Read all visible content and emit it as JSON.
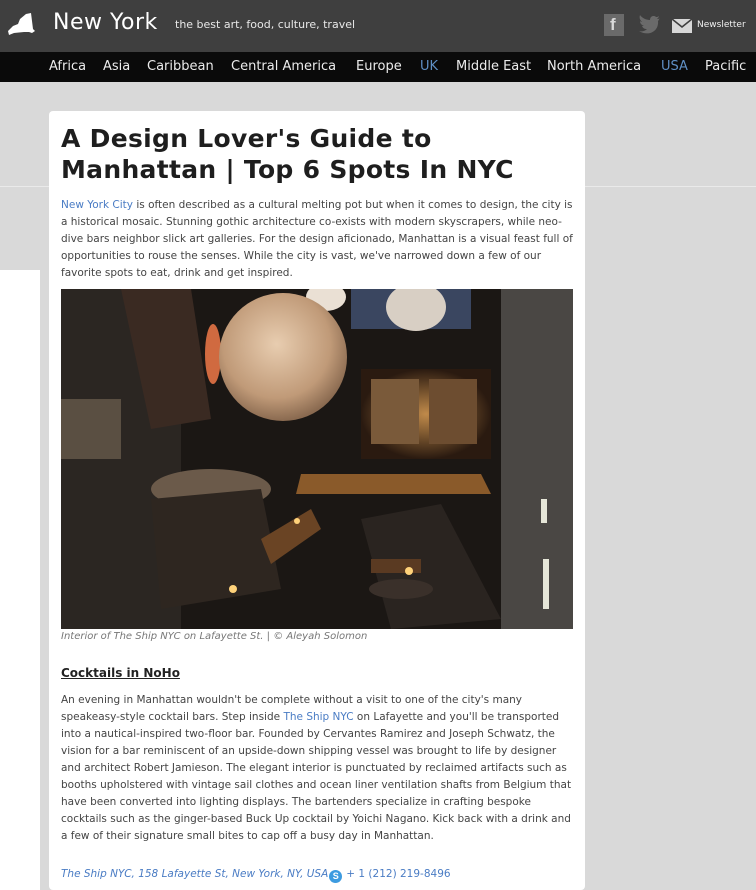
{
  "header": {
    "site_title": "New York",
    "tagline": "the best art, food, culture, travel",
    "newsletter_label": "Newsletter",
    "facebook_glyph": "f",
    "icons": [
      "ny-state-logo-icon",
      "facebook-icon",
      "twitter-icon",
      "mail-icon"
    ]
  },
  "regions": [
    {
      "label": "Africa",
      "active": false
    },
    {
      "label": "Asia",
      "active": false
    },
    {
      "label": "Caribbean",
      "active": false
    },
    {
      "label": "Central America",
      "active": false
    },
    {
      "label": "Europe",
      "active": false
    },
    {
      "label": "UK",
      "active": true
    },
    {
      "label": "Middle East",
      "active": false
    },
    {
      "label": "North America",
      "active": false
    },
    {
      "label": "USA",
      "active": true
    },
    {
      "label": "Pacific",
      "active": false
    }
  ],
  "article": {
    "title": "A Design Lover's Guide to Manhattan | Top 6 Spots In NYC",
    "intro_link": "New York City",
    "intro_text": " is often described as a cultural melting pot but when it comes to design, the city is a historical mosaic. Stunning gothic architecture co-exists with modern skyscrapers, while neo-dive bars neighbor slick art galleries. For the design aficionado, Manhattan is a visual feast full of opportunities to rouse the senses. While the city is vast, we've narrowed down a few of our favorite spots to eat, drink and get inspired.",
    "photo_caption": "Interior of The Ship NYC on Lafayette St. | © Aleyah Solomon",
    "section_heading": "Cocktails in NoHo",
    "section_text_before": "An evening in Manhattan wouldn't be complete without a visit to one of the city's many speakeasy-style cocktail bars. Step inside ",
    "section_link": "The Ship NYC",
    "section_text_after": " on Lafayette and you'll be transported into a nautical-inspired two-floor bar. Founded by Cervantes Ramirez and Joseph Schwatz, the vision for a bar reminiscent of an upside-down shipping vessel was brought to life by designer and architect Robert Jamieson. The elegant interior is punctuated by reclaimed artifacts such as booths upholstered with vintage sail clothes and ocean liner ventilation shafts from Belgium that have been converted into lighting displays. The bartenders specialize in crafting bespoke cocktails such as the ginger-based Buck Up cocktail by Yoichi Nagano. Kick back with a drink and a few of their signature small bites to cap off a busy day in Manhattan.",
    "address": "The Ship NYC, 158 Lafayette St, New York, NY, USA",
    "skype_glyph": "S",
    "phone": "+ 1 (212) 219-8496"
  },
  "colors": {
    "topbar": "#3f3f3f",
    "regionbar": "#0a0a0a",
    "active_region": "#5f8fc4",
    "link": "#4a7cc4",
    "page_bg": "#d9d9d9"
  }
}
